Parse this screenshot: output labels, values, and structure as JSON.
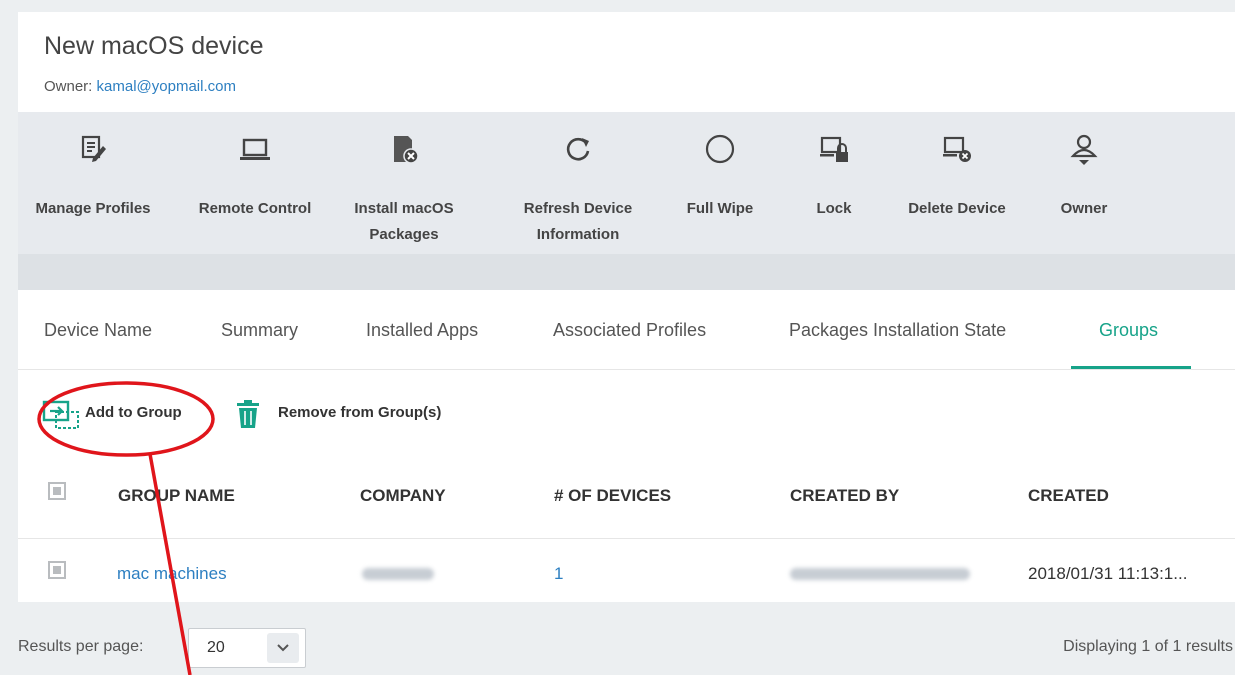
{
  "device": {
    "title": "New macOS device",
    "owner_label": "Owner:",
    "owner_email": "kamal@yopmail.com"
  },
  "toolbar": {
    "manage_profiles": "Manage Profiles",
    "remote_control": "Remote Control",
    "install_packages_1": "Install macOS",
    "install_packages_2": "Packages",
    "refresh_1": "Refresh Device",
    "refresh_2": "Information",
    "full_wipe": "Full Wipe",
    "lock": "Lock",
    "delete_device": "Delete Device",
    "owner": "Owner"
  },
  "tabs": [
    {
      "label": "Device Name"
    },
    {
      "label": "Summary"
    },
    {
      "label": "Installed Apps"
    },
    {
      "label": "Associated Profiles"
    },
    {
      "label": "Packages Installation State"
    },
    {
      "label": "Groups",
      "active": true
    }
  ],
  "actions": {
    "add_to_group": "Add to Group",
    "remove_from_group": "Remove from Group(s)"
  },
  "table": {
    "columns": [
      "GROUP NAME",
      "COMPANY",
      "# OF DEVICES",
      "CREATED BY",
      "CREATED"
    ],
    "rows": [
      {
        "group_name": "mac machines",
        "devices": "1",
        "created": "2018/01/31 11:13:1..."
      }
    ]
  },
  "footer": {
    "results_label": "Results per page:",
    "per_page": "20",
    "displaying": "Displaying 1 of 1 results"
  },
  "colors": {
    "accent": "#17a389",
    "link": "#2d7fc1",
    "annotation": "#e0151b"
  }
}
